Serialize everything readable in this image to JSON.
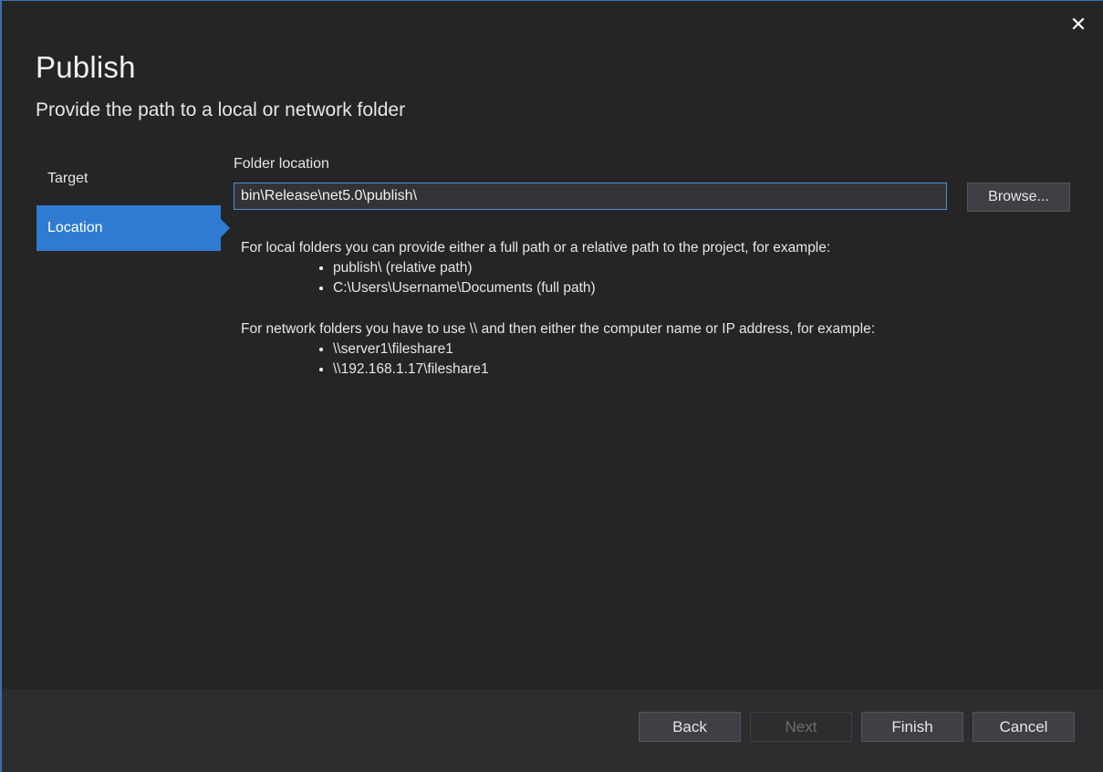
{
  "window": {
    "close_glyph": "✕",
    "title": "Publish",
    "subtitle": "Provide the path to a local or network folder"
  },
  "nav": {
    "items": [
      {
        "label": "Target",
        "active": false
      },
      {
        "label": "Location",
        "active": true
      }
    ]
  },
  "location": {
    "field_label": "Folder location",
    "folder_path_value": "bin\\Release\\net5.0\\publish\\",
    "browse_label": "Browse..."
  },
  "help": {
    "local_intro": "For local folders you can provide either a full path or a relative path to the project, for example:",
    "local_examples": [
      "publish\\ (relative path)",
      "C:\\Users\\Username\\Documents (full path)"
    ],
    "network_intro": "For network folders you have to use \\\\ and then either the computer name or IP address, for example:",
    "network_examples": [
      "\\\\server1\\fileshare1",
      "\\\\192.168.1.17\\fileshare1"
    ]
  },
  "footer": {
    "back_label": "Back",
    "next_label": "Next",
    "finish_label": "Finish",
    "cancel_label": "Cancel"
  },
  "colors": {
    "background": "#252526",
    "footer_background": "#2d2d30",
    "accent": "#2f7bd1",
    "input_border": "#4d8fd8"
  },
  "icons": {
    "close": "close-icon"
  }
}
